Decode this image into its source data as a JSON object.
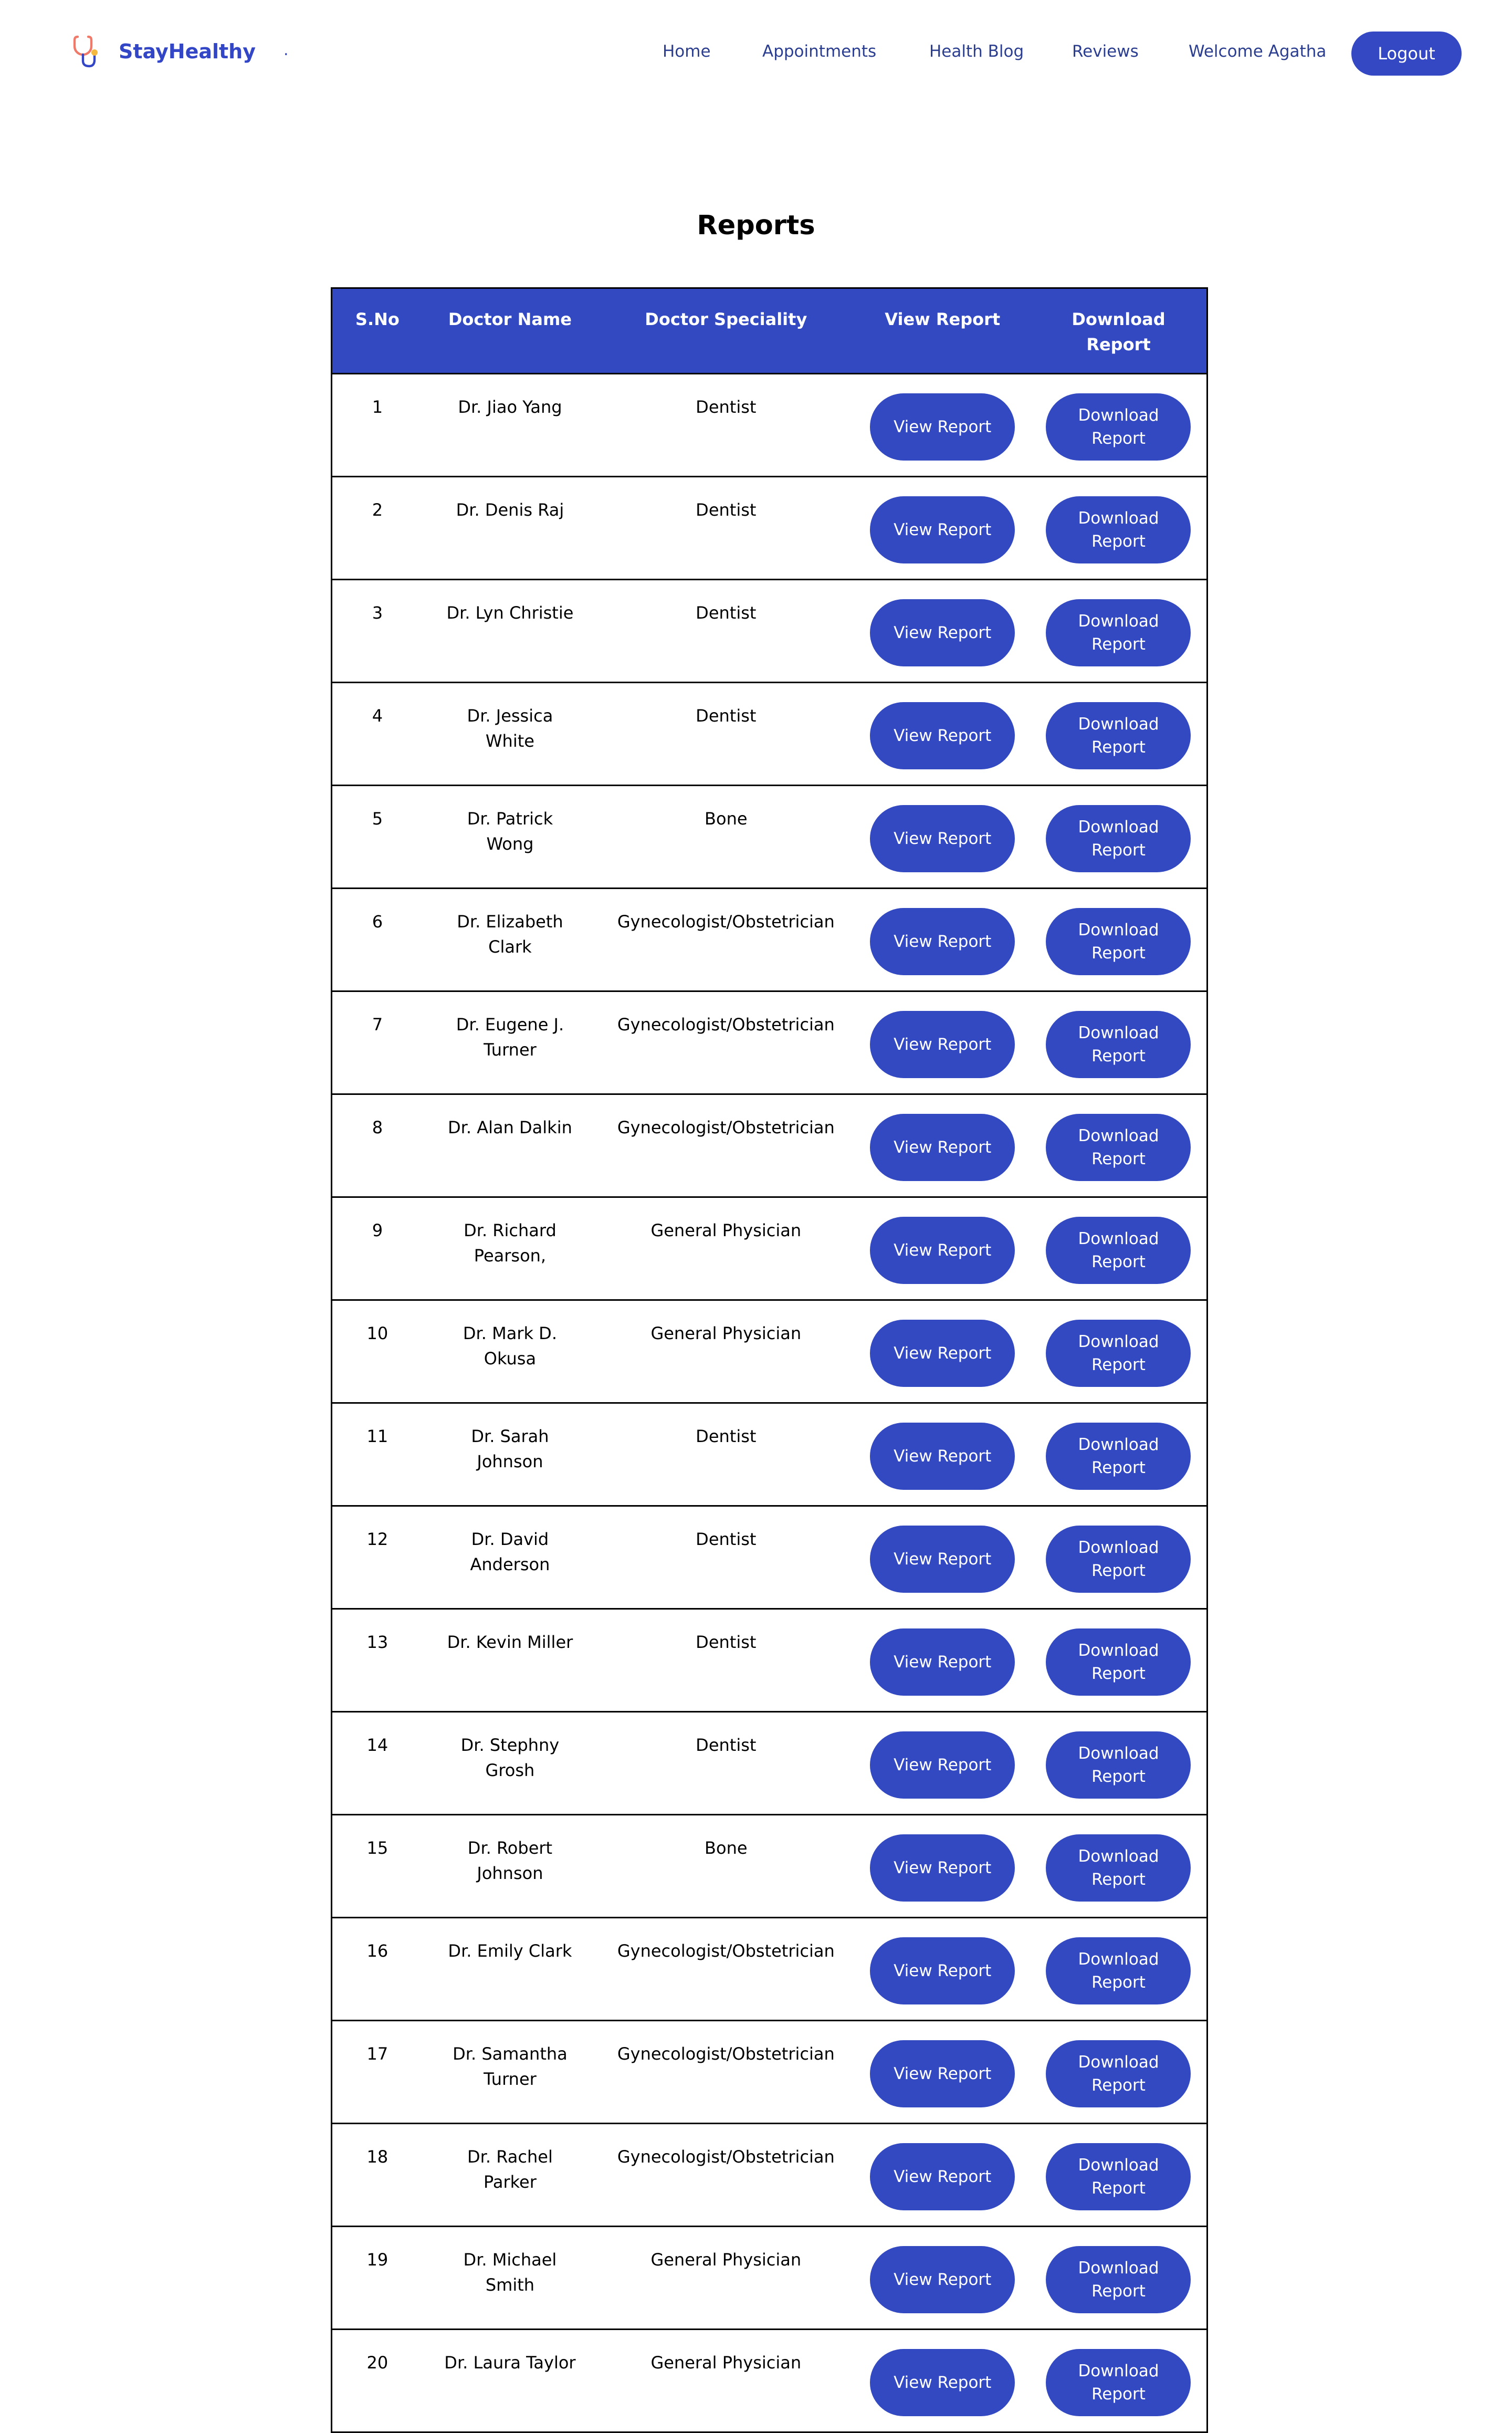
{
  "brand": {
    "name": "StayHealthy",
    "dot": ".",
    "accent": "#3346c6",
    "icon": "stethoscope-icon"
  },
  "nav": {
    "home": "Home",
    "appointments": "Appointments",
    "health_blog": "Health Blog",
    "reviews": "Reviews",
    "welcome": "Welcome Agatha",
    "logout": "Logout"
  },
  "page": {
    "title": "Reports"
  },
  "table": {
    "headers": [
      "S.No",
      "Doctor Name",
      "Doctor Speciality",
      "View Report",
      "Download Report"
    ],
    "view_label": "View Report",
    "download_label": "Download Report",
    "header_color": "#3349c2",
    "rows": [
      {
        "sno": "1",
        "name": "Dr. Jiao Yang",
        "speciality": "Dentist"
      },
      {
        "sno": "2",
        "name": "Dr. Denis Raj",
        "speciality": "Dentist"
      },
      {
        "sno": "3",
        "name": "Dr. Lyn Christie",
        "speciality": "Dentist"
      },
      {
        "sno": "4",
        "name": "Dr. Jessica White",
        "speciality": "Dentist"
      },
      {
        "sno": "5",
        "name": "Dr. Patrick Wong",
        "speciality": "Bone"
      },
      {
        "sno": "6",
        "name": "Dr. Elizabeth Clark",
        "speciality": "Gynecologist/Obstetrician"
      },
      {
        "sno": "7",
        "name": "Dr. Eugene J. Turner",
        "speciality": "Gynecologist/Obstetrician"
      },
      {
        "sno": "8",
        "name": "Dr. Alan Dalkin",
        "speciality": "Gynecologist/Obstetrician"
      },
      {
        "sno": "9",
        "name": "Dr. Richard Pearson,",
        "speciality": "General Physician"
      },
      {
        "sno": "10",
        "name": "Dr. Mark D. Okusa",
        "speciality": "General Physician"
      },
      {
        "sno": "11",
        "name": "Dr. Sarah Johnson",
        "speciality": "Dentist"
      },
      {
        "sno": "12",
        "name": "Dr. David Anderson",
        "speciality": "Dentist"
      },
      {
        "sno": "13",
        "name": "Dr. Kevin Miller",
        "speciality": "Dentist"
      },
      {
        "sno": "14",
        "name": "Dr. Stephny Grosh",
        "speciality": "Dentist"
      },
      {
        "sno": "15",
        "name": "Dr. Robert Johnson",
        "speciality": "Bone"
      },
      {
        "sno": "16",
        "name": "Dr. Emily Clark",
        "speciality": "Gynecologist/Obstetrician"
      },
      {
        "sno": "17",
        "name": "Dr. Samantha Turner",
        "speciality": "Gynecologist/Obstetrician"
      },
      {
        "sno": "18",
        "name": "Dr. Rachel Parker",
        "speciality": "Gynecologist/Obstetrician"
      },
      {
        "sno": "19",
        "name": "Dr. Michael Smith",
        "speciality": "General Physician"
      },
      {
        "sno": "20",
        "name": "Dr. Laura Taylor",
        "speciality": "General Physician"
      }
    ]
  }
}
